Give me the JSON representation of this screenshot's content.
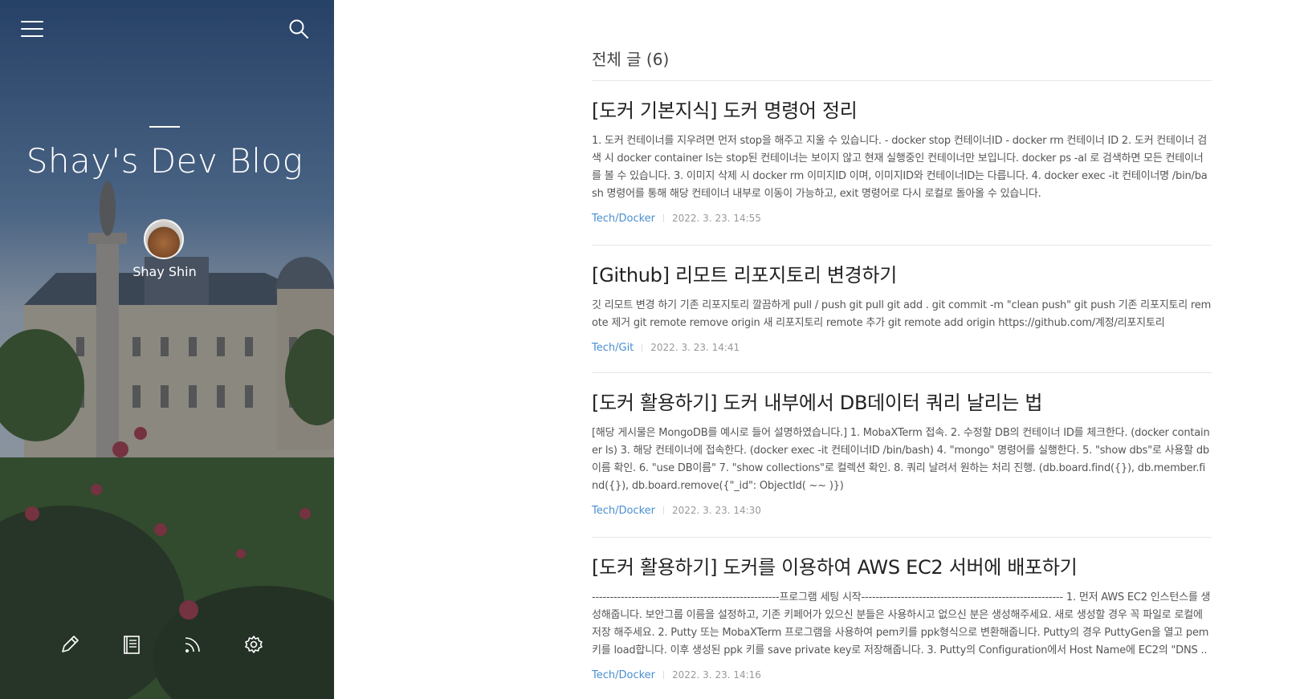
{
  "sidebar": {
    "blog_title": "Shay's Dev Blog",
    "author_name": "Shay Shin",
    "icons": [
      "menu-icon",
      "search-icon",
      "write-icon",
      "guestbook-icon",
      "rss-icon",
      "settings-icon"
    ]
  },
  "colors": {
    "category_link": "#4a8ed0",
    "title_text": "#222222",
    "excerpt_text": "#555555",
    "date_text": "#999999"
  },
  "main": {
    "heading": "전체 글 (6)",
    "posts": [
      {
        "title": "[도커 기본지식] 도커 명령어 정리",
        "excerpt": "1. 도커 컨테이너를 지우려면 먼저 stop을 해주고 지울 수 있습니다. - docker stop 컨테이너ID - docker rm 컨테이너 ID 2. 도커 컨테이너 검색 시 docker container ls는 stop된 컨테이너는 보이지 않고 현재 실행중인 컨테이너만 보입니다. docker ps -al 로 검색하면 모든 컨테이너를 볼 수 있습니다. 3. 이미지 삭제 시 docker rm 이미지ID 이며, 이미지ID와 컨테이너ID는 다릅니다. 4. docker exec -it 컨테이너명 /bin/bash 명령어를 통해 해당 컨테이너 내부로 이동이 가능하고, exit 명령어로 다시 로컬로 돌아올 수 있습니다.",
        "category": "Tech/Docker",
        "date": "2022. 3. 23. 14:55"
      },
      {
        "title": "[Github] 리모트 리포지토리 변경하기",
        "excerpt": "깃 리모트 변경 하기 기존 리포지토리 깔끔하게 pull / push git pull git add . git commit -m \"clean push\" git push 기존 리포지토리 remote 제거 git remote remove origin 새 리포지토리 remote 추가 git remote add origin https://github.com/계정/리포지토리",
        "category": "Tech/Git",
        "date": "2022. 3. 23. 14:41"
      },
      {
        "title": "[도커 활용하기] 도커 내부에서 DB데이터 쿼리 날리는 법",
        "excerpt": "[해당 게시물은 MongoDB를 예시로 들어 설명하였습니다.] 1. MobaXTerm 접속. 2. 수정할 DB의 컨테이너 ID를 체크한다. (docker container ls) 3. 해당 컨테이너에 접속한다. (docker exec -it 컨테이너ID /bin/bash) 4. \"mongo\" 명령어를 실행한다. 5. \"show dbs\"로 사용할 db이름 확인. 6. \"use DB이름\" 7. \"show collections\"로 컬렉션 확인. 8. 쿼리 날려서 원하는 처리 진행. (db.board.find({}), db.member.find({}), db.board.remove({\"_id\": ObjectId( ~~ )})",
        "category": "Tech/Docker",
        "date": "2022. 3. 23. 14:30"
      },
      {
        "title": "[도커 활용하기] 도커를 이용하여 AWS EC2 서버에 배포하기",
        "excerpt": "----------------------------------------------------프로그램 세팅 시작-------------------------------------------------------- 1. 먼저 AWS EC2 인스턴스를 생성해줍니다. 보안그룹 이름을 설정하고, 기존 키페어가 있으신 분들은 사용하시고 없으신 분은 생성해주세요. 새로 생성할 경우 꼭 파일로 로컬에 저장 해주세요. 2. Putty 또는 MobaXTerm 프로그램을 사용하여 pem키를 ppk형식으로 변환해줍니다. Putty의 경우 PuttyGen을 열고 pem키를 load합니다. 이후 생성된 ppk 키를 save private key로 저장해줍니다. 3. Putty의 Configuration에서 Host Name에 EC2의 \"DNS ..",
        "category": "Tech/Docker",
        "date": "2022. 3. 23. 14:16"
      }
    ]
  }
}
